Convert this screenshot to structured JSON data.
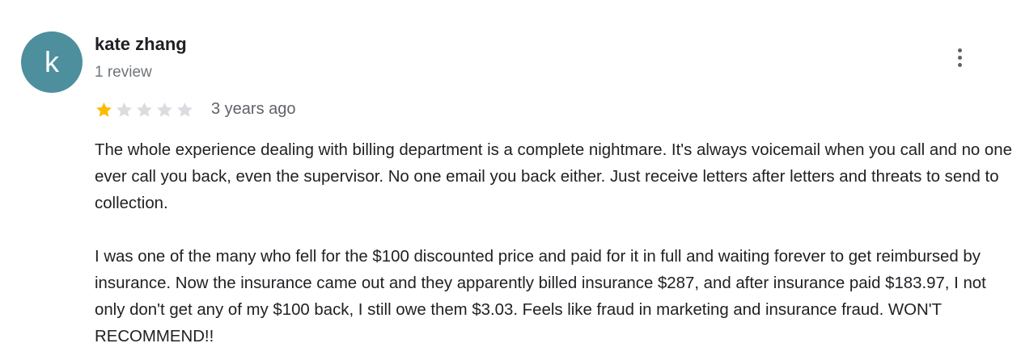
{
  "review": {
    "avatar_letter": "k",
    "avatar_color": "#4e8f9d",
    "reviewer_name": "kate zhang",
    "review_count": "1 review",
    "rating": 1,
    "rating_max": 5,
    "star_filled_color": "#fbbc04",
    "star_empty_color": "#dadce0",
    "date": "3 years ago",
    "more_icon": "more-vert-icon",
    "paragraphs": [
      "The whole experience dealing with billing department is a complete nightmare. It's always voicemail when you call and no one ever call you back, even the supervisor. No one email you back either. Just receive letters after letters and threats to send to collection.",
      "I was one of the many who fell for the $100 discounted price and paid for it in full and waiting forever to get reimbursed by insurance. Now the insurance came out and they apparently billed insurance $287, and after insurance paid $183.97, I not only don't get any of my $100 back, I still owe them $3.03. Feels like fraud in marketing and insurance fraud. WON'T RECOMMEND!!"
    ]
  }
}
